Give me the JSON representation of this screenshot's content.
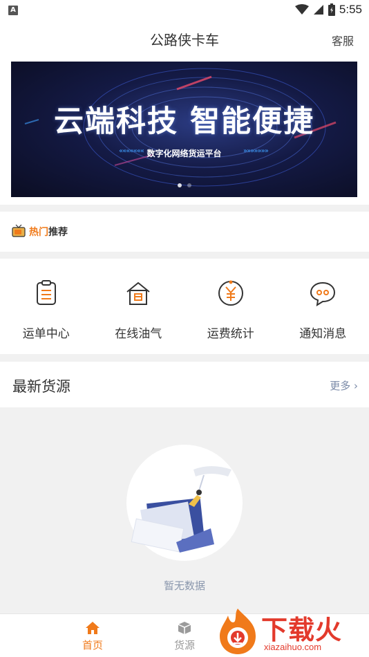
{
  "status_bar": {
    "indicator": "A",
    "time": "5:55"
  },
  "header": {
    "title": "公路侠卡车",
    "service_label": "客服"
  },
  "banner": {
    "title": "云端科技 智能便捷",
    "subtitle": "数字化网络货运平台",
    "arrows_left": "«««««««",
    "arrows_right": "»»»»»»»"
  },
  "hot": {
    "label_a": "热门",
    "label_b": "推荐"
  },
  "menu": {
    "items": [
      {
        "label": "运单中心",
        "icon": "clipboard-icon"
      },
      {
        "label": "在线油气",
        "icon": "gas-station-icon"
      },
      {
        "label": "运费统计",
        "icon": "yuan-icon"
      },
      {
        "label": "通知消息",
        "icon": "chat-bubble-icon"
      }
    ]
  },
  "latest": {
    "title": "最新货源",
    "more_label": "更多 ›"
  },
  "empty": {
    "text": "暂无数据"
  },
  "tabbar": {
    "tabs": [
      {
        "label": "首页",
        "icon": "home-icon",
        "active": true
      },
      {
        "label": "货源",
        "icon": "box-icon",
        "active": false
      }
    ]
  },
  "watermark": {
    "text": "下载火",
    "sub": "xiazaihuo.com"
  },
  "colors": {
    "accent": "#f07a1a",
    "gray_bg": "#f1f1f1",
    "link": "#7a8aa8",
    "watermark": "#e33a2c"
  }
}
